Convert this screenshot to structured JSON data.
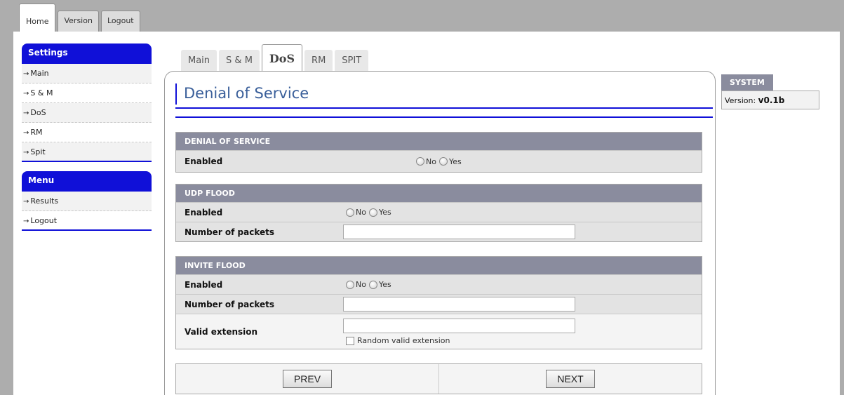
{
  "top_tabs": [
    {
      "label": "Home"
    },
    {
      "label": "Version"
    },
    {
      "label": "Logout"
    }
  ],
  "sidebar": {
    "settings": {
      "title": "Settings",
      "items": [
        {
          "label": "Main"
        },
        {
          "label": "S & M"
        },
        {
          "label": "DoS"
        },
        {
          "label": "RM"
        },
        {
          "label": "Spit"
        }
      ]
    },
    "menu": {
      "title": "Menu",
      "items": [
        {
          "label": "Results"
        },
        {
          "label": "Logout"
        }
      ]
    }
  },
  "content_tabs": [
    {
      "label": "Main"
    },
    {
      "label": "S & M"
    },
    {
      "label": "DoS"
    },
    {
      "label": "RM"
    },
    {
      "label": "SPIT"
    }
  ],
  "page": {
    "title": "Denial of Service"
  },
  "sections": {
    "dos": {
      "heading": "DENIAL OF SERVICE",
      "enabled_label": "Enabled",
      "no": "No",
      "yes": "Yes"
    },
    "udp": {
      "heading": "UDP FLOOD",
      "enabled_label": "Enabled",
      "no": "No",
      "yes": "Yes",
      "packets_label": "Number of packets",
      "packets_value": ""
    },
    "invite": {
      "heading": "INVITE FLOOD",
      "enabled_label": "Enabled",
      "no": "No",
      "yes": "Yes",
      "packets_label": "Number of packets",
      "packets_value": "",
      "extension_label": "Valid extension",
      "extension_value": "",
      "random_label": "Random valid extension"
    }
  },
  "buttons": {
    "prev": "PREV",
    "next": "NEXT"
  },
  "system": {
    "heading": "SYSTEM",
    "version_label": "Version:",
    "version_value": "v0.1b"
  },
  "colors": {
    "accent": "#1010d8",
    "section_header": "#8a8c9e",
    "title": "#3a5f9a"
  }
}
